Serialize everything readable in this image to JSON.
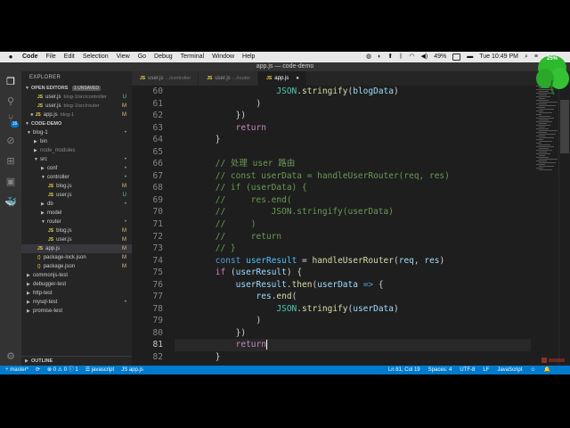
{
  "menubar": {
    "app": "Code",
    "items": [
      "File",
      "Edit",
      "Selection",
      "View",
      "Go",
      "Debug",
      "Terminal",
      "Window",
      "Help"
    ],
    "battery": "49%",
    "clock": "Tue 10:49 PM"
  },
  "window": {
    "title": "app.js — code-demo"
  },
  "overlay_badge": "25%",
  "activity_badge": "16",
  "sidebar": {
    "title": "EXPLORER",
    "open_editors": {
      "label": "OPEN EDITORS",
      "unsaved": "1 UNSAVED"
    },
    "open_files": [
      {
        "name": "user.js",
        "desc": "blog-1/src/controller",
        "status": "U"
      },
      {
        "name": "user.js",
        "desc": "blog-1/src/router",
        "status": "M"
      },
      {
        "name": "app.js",
        "desc": "blog-1",
        "status": "M"
      }
    ],
    "project": "CODE-DEMO",
    "tree": [
      {
        "name": "blog-1",
        "status": "•"
      },
      {
        "name": "bin",
        "status": ""
      },
      {
        "name": "node_modules",
        "status": ""
      },
      {
        "name": "src",
        "status": "•"
      },
      {
        "name": "conf",
        "status": "•"
      },
      {
        "name": "controller",
        "status": "•"
      },
      {
        "name": "blog.js",
        "status": "M"
      },
      {
        "name": "user.js",
        "status": "U"
      },
      {
        "name": "db",
        "status": "•"
      },
      {
        "name": "model",
        "status": ""
      },
      {
        "name": "router",
        "status": "•"
      },
      {
        "name": "blog.js",
        "status": "M"
      },
      {
        "name": "user.js",
        "status": "M"
      },
      {
        "name": "app.js",
        "status": "M"
      },
      {
        "name": "package-lock.json",
        "status": "M"
      },
      {
        "name": "package.json",
        "status": "M"
      },
      {
        "name": "commonjs-test",
        "status": ""
      },
      {
        "name": "debugger-test",
        "status": ""
      },
      {
        "name": "http-test",
        "status": ""
      },
      {
        "name": "mysql-test",
        "status": "•"
      },
      {
        "name": "promise-test",
        "status": ""
      }
    ],
    "outline": "OUTLINE"
  },
  "tabs": [
    {
      "name": "user.js",
      "path": ".../controller"
    },
    {
      "name": "user.js",
      "path": ".../router"
    },
    {
      "name": "app.js",
      "path": ""
    }
  ],
  "editor": {
    "line_numbers": [
      "60",
      "61",
      "62",
      "63",
      "64",
      "65",
      "66",
      "67",
      "68",
      "69",
      "70",
      "71",
      "72",
      "73",
      "74",
      "75",
      "76",
      "77",
      "78",
      "79",
      "80",
      "81",
      "82"
    ],
    "lines": [
      "                    JSON.stringify(blogData)",
      "                )",
      "            })",
      "            return",
      "        }",
      "",
      "        // 处理 user 路由",
      "        // const userData = handleUserRouter(req, res)",
      "        // if (userData) {",
      "        //     res.end(",
      "        //         JSON.stringify(userData)",
      "        //     )",
      "        //     return",
      "        // }",
      "        const userResult = handleUserRouter(req, res)",
      "        if (userResult) {",
      "            userResult.then(userData => {",
      "                res.end(",
      "                    JSON.stringify(userData)",
      "                )",
      "            })",
      "            return",
      "        }"
    ]
  },
  "statusbar": {
    "branch": "master*",
    "sync": "⟳",
    "problems": "⊗ 0 ⚠ 0 ⓘ 1",
    "language_mode": "javascript",
    "file": "app.js",
    "position": "Ln 81, Col 19",
    "spaces": "Spaces: 4",
    "encoding": "UTF-8",
    "eol": "LF",
    "language": "JavaScript"
  }
}
